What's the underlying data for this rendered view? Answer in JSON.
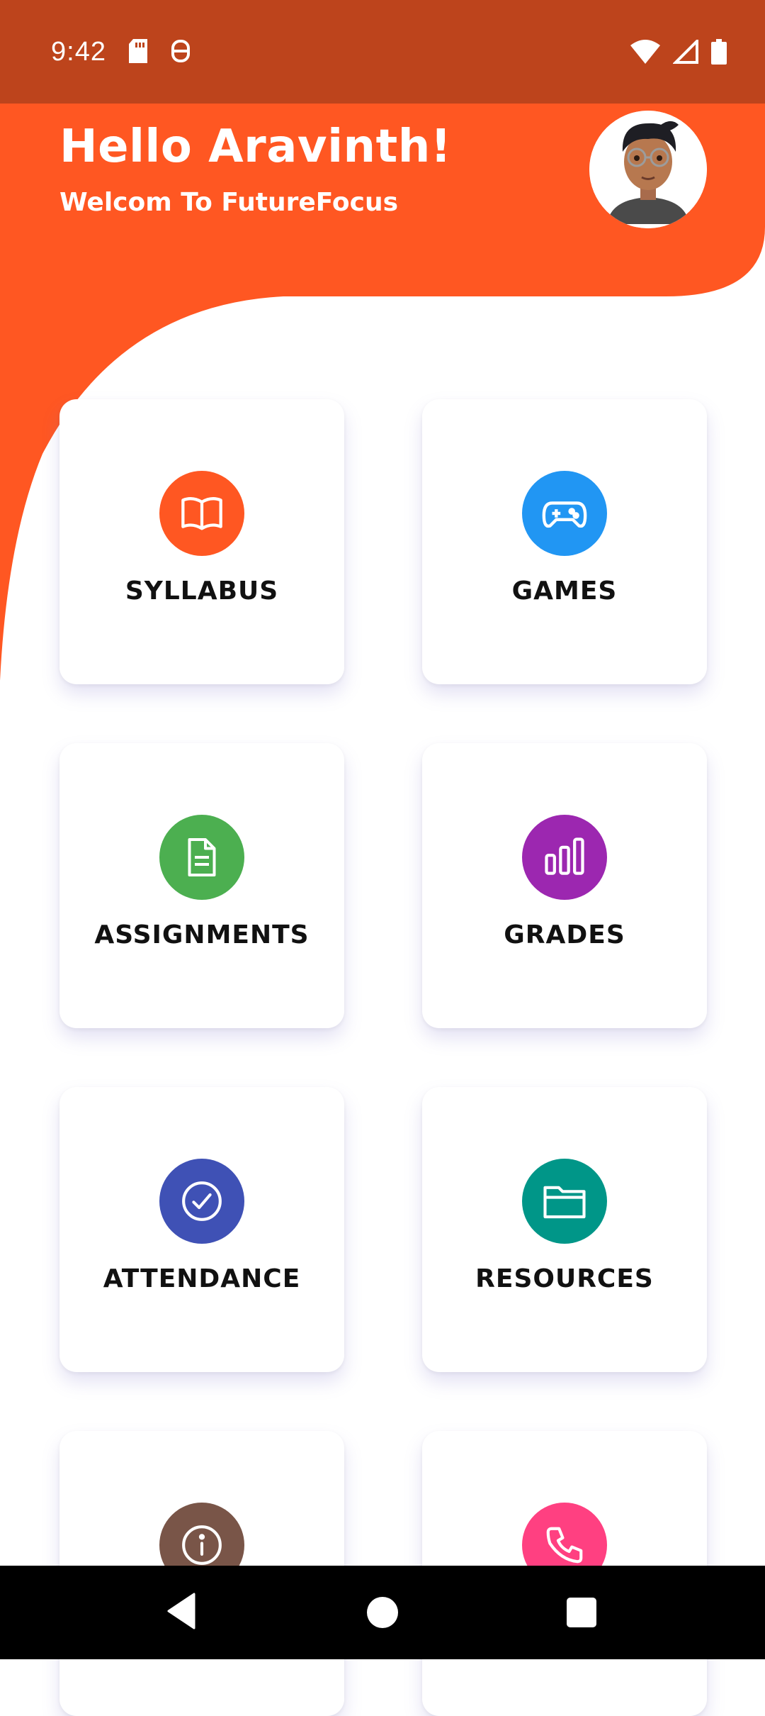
{
  "status": {
    "time": "9:42"
  },
  "header": {
    "greeting": "Hello Aravinth!",
    "subtitle": "Welcom To FutureFocus",
    "primary_color": "#FF5722"
  },
  "menu": [
    {
      "label": "SYLLABUS",
      "icon": "book-open-icon",
      "color": "#FF5722"
    },
    {
      "label": "GAMES",
      "icon": "gamepad-icon",
      "color": "#2196F3"
    },
    {
      "label": "ASSIGNMENTS",
      "icon": "document-icon",
      "color": "#4CAF50"
    },
    {
      "label": "GRADES",
      "icon": "bar-chart-icon",
      "color": "#9C27B0"
    },
    {
      "label": "ATTENDANCE",
      "icon": "check-circle-icon",
      "color": "#3F51B5"
    },
    {
      "label": "RESOURCES",
      "icon": "folder-icon",
      "color": "#009688"
    },
    {
      "label": "",
      "icon": "info-icon",
      "color": "#795548"
    },
    {
      "label": "",
      "icon": "phone-icon",
      "color": "#FF4081"
    }
  ]
}
